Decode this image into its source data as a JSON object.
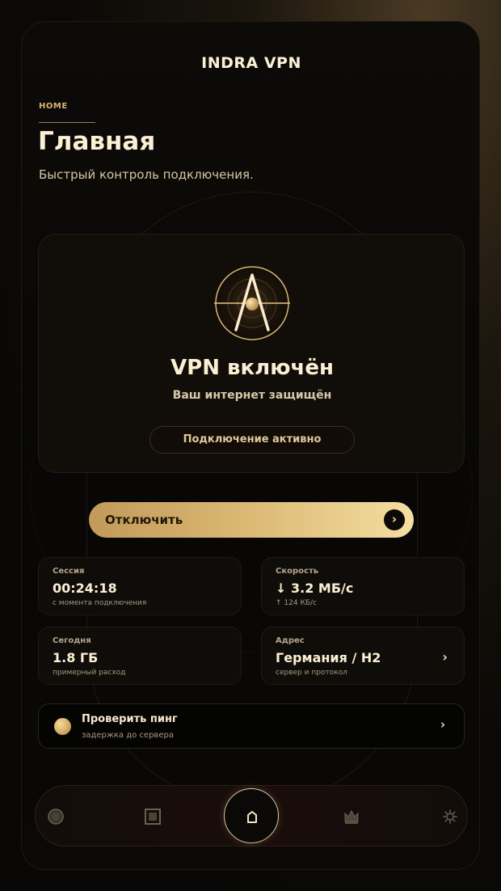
{
  "app": {
    "title": "INDRA VPN"
  },
  "header": {
    "breadcrumb": "HOME",
    "title": "Главная",
    "subtitle": "Быстрый контроль подключения."
  },
  "status": {
    "title": "VPN включён",
    "subtitle": "Ваш интернет защищён",
    "pill": "Подключение активно"
  },
  "disconnect": {
    "label": "Отключить",
    "arrow": "›"
  },
  "stats": {
    "session": {
      "label": "Сессия",
      "value": "00:24:18",
      "note": "с момента подключения"
    },
    "speed": {
      "label": "Скорость",
      "value": "↓ 3.2 МБ/с",
      "note": "↑ 124 КБ/с"
    },
    "today": {
      "label": "Сегодня",
      "value": "1.8 ГБ",
      "note": "примерный расход"
    },
    "address": {
      "label": "Адрес",
      "value": "Германия / H2",
      "note": "сервер и протокол",
      "chevron": "›"
    }
  },
  "ping": {
    "title": "Проверить пинг",
    "subtitle": "задержка до сервера",
    "chevron": "›"
  },
  "tabbar": {
    "icons": [
      "globe-icon",
      "servers-icon",
      "home-icon",
      "crown-icon",
      "gear-icon"
    ]
  },
  "colors": {
    "accent": "#d9b671",
    "accent_light": "#f4dea1",
    "background": "#0a0806",
    "text": "#fbf0d4"
  }
}
